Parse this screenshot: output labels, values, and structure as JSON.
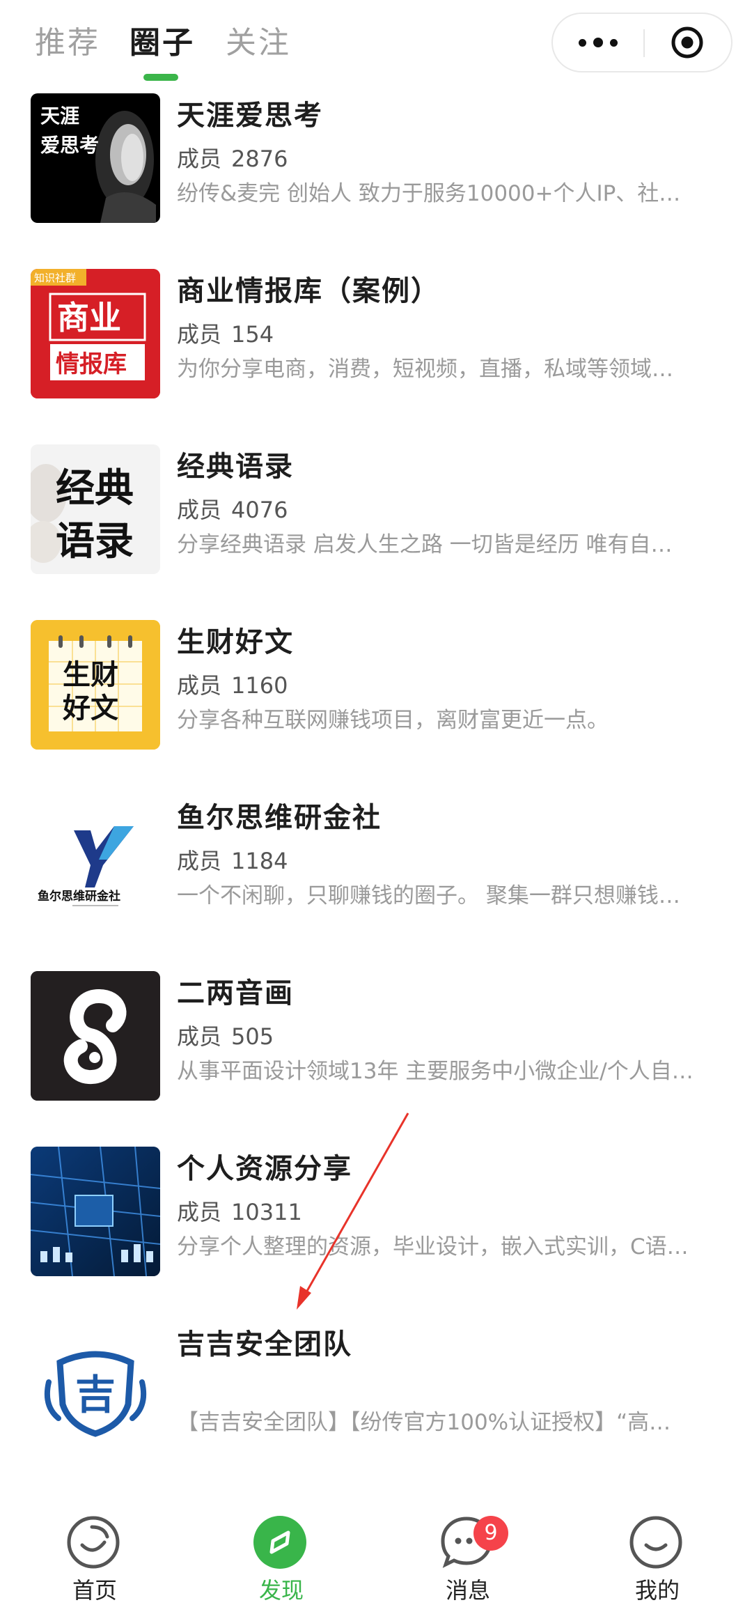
{
  "tabs": [
    {
      "label": "推荐",
      "active": false
    },
    {
      "label": "圈子",
      "active": true
    },
    {
      "label": "关注",
      "active": false
    }
  ],
  "members_label": "成员",
  "groups": [
    {
      "name": "天涯爱思考",
      "members": "2876",
      "desc": "纷传&麦完 创始人 致力于服务10000+个人IP、社…",
      "thumb_text": [
        "天涯",
        "爱思考"
      ]
    },
    {
      "name": "商业情报库（案例）",
      "members": "154",
      "desc": "为你分享电商，消费，短视频，直播，私域等领域…",
      "thumb_text": [
        "知识社群",
        "商业",
        "情报库"
      ]
    },
    {
      "name": "经典语录",
      "members": "4076",
      "desc": "分享经典语录 启发人生之路 一切皆是经历 唯有自…",
      "thumb_text": [
        "经典",
        "语录"
      ]
    },
    {
      "name": "生财好文",
      "members": "1160",
      "desc": "分享各种互联网赚钱项目，离财富更近一点。",
      "thumb_text": [
        "生财",
        "好文"
      ]
    },
    {
      "name": "鱼尔思维研金社",
      "members": "1184",
      "desc": "一个不闲聊，只聊赚钱的圈子。 聚集一群只想赚钱…",
      "thumb_text": [
        "鱼尔思维研金社"
      ]
    },
    {
      "name": "二两音画",
      "members": "505",
      "desc": "从事平面设计领域13年 主要服务中小微企业/个人自…",
      "thumb_text": []
    },
    {
      "name": "个人资源分享",
      "members": "10311",
      "desc": "分享个人整理的资源，毕业设计，嵌入式实训，C语…",
      "thumb_text": []
    },
    {
      "name": "吉吉安全团队",
      "members": "",
      "desc": "【吉吉安全团队】【纷传官方100%认证授权】“高…",
      "thumb_text": [
        "吉"
      ]
    }
  ],
  "bottom_nav": [
    {
      "label": "首页",
      "icon": "home-smile-icon",
      "active": false
    },
    {
      "label": "发现",
      "icon": "compass-icon",
      "active": true
    },
    {
      "label": "消息",
      "icon": "chat-bubble-icon",
      "active": false,
      "badge": "9"
    },
    {
      "label": "我的",
      "icon": "profile-smile-icon",
      "active": false
    }
  ],
  "colors": {
    "accent": "#39b54a",
    "badge": "#f5434a",
    "annotation_arrow": "#e8332a"
  }
}
